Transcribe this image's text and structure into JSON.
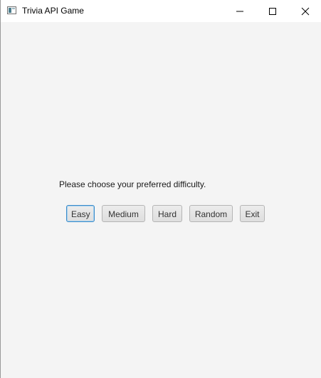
{
  "window": {
    "title": "Trivia API Game",
    "icon": "app-window-icon",
    "controls": {
      "minimize_icon": "minimize-icon",
      "maximize_icon": "maximize-icon",
      "close_icon": "close-icon"
    }
  },
  "main": {
    "prompt": "Please choose your preferred difficulty.",
    "buttons": {
      "easy": "Easy",
      "medium": "Medium",
      "hard": "Hard",
      "random": "Random",
      "exit": "Exit"
    },
    "focused_button": "easy"
  },
  "colors": {
    "background": "#f4f4f4",
    "focus_border": "#3b8bc8"
  }
}
